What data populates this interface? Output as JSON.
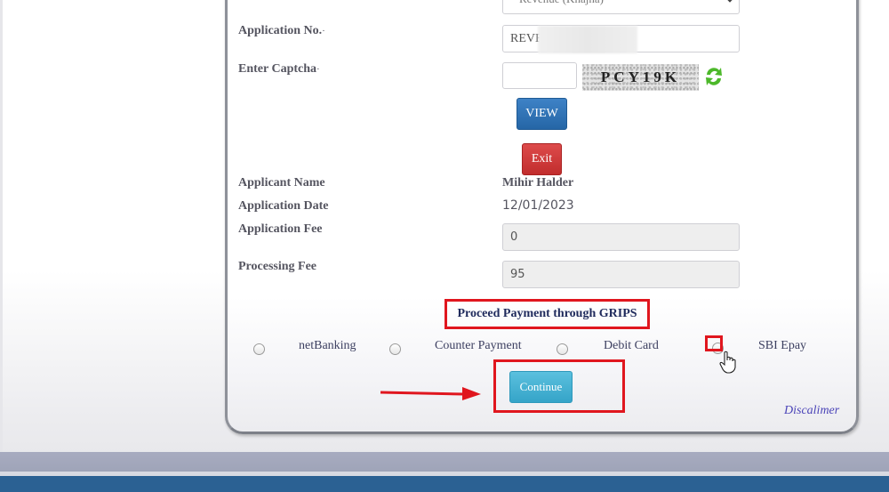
{
  "form": {
    "revenue_type": {
      "selected": "Revenue (Khajna)"
    },
    "application_no": {
      "label": "Application No.",
      "required_mark": "·",
      "value": "REVE"
    },
    "captcha": {
      "label": "Enter Captcha",
      "required_mark": "·",
      "value": "",
      "image_text": "PCY19K"
    },
    "buttons": {
      "view": "VIEW",
      "exit": "Exit",
      "continue": "Continue"
    },
    "details": {
      "applicant_name": {
        "label": "Applicant Name",
        "value": "Mihir Halder"
      },
      "application_date": {
        "label": "Application Date",
        "value": "12/01/2023"
      },
      "application_fee": {
        "label": "Application Fee",
        "value": "0"
      },
      "processing_fee": {
        "label": "Processing Fee",
        "value": "95"
      }
    }
  },
  "payment": {
    "title": "Proceed Payment through GRIPS",
    "options": [
      {
        "label": "netBanking",
        "selected": false
      },
      {
        "label": "Counter Payment",
        "selected": false
      },
      {
        "label": "Debit Card",
        "selected": false
      },
      {
        "label": "SBI Epay",
        "selected": false
      }
    ]
  },
  "footer": {
    "disclaimer": "Discalimer"
  },
  "annotation": {
    "highlight_color": "#e0161e"
  }
}
